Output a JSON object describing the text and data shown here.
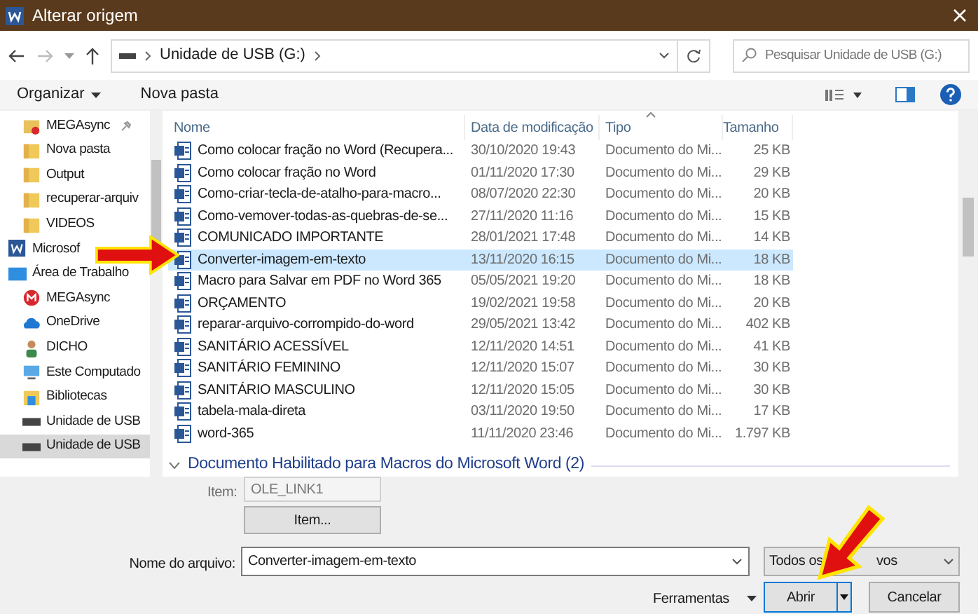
{
  "window": {
    "title": "Alterar origem"
  },
  "address": {
    "path": "Unidade de USB (G:)",
    "search_placeholder": "Pesquisar Unidade de USB (G:)"
  },
  "toolbar": {
    "organize": "Organizar",
    "new_folder": "Nova pasta"
  },
  "sidebar": {
    "items": [
      {
        "label": "MEGAsync",
        "kind": "megafolder",
        "indented": true,
        "pinned": true,
        "selected": false
      },
      {
        "label": "Nova pasta",
        "kind": "folder",
        "indented": true,
        "pinned": false,
        "selected": false
      },
      {
        "label": "Output",
        "kind": "folder",
        "indented": true,
        "pinned": false,
        "selected": false
      },
      {
        "label": "recuperar-arquiv",
        "kind": "folder",
        "indented": true,
        "pinned": false,
        "selected": false
      },
      {
        "label": "VIDEOS",
        "kind": "folder",
        "indented": true,
        "pinned": false,
        "selected": false
      },
      {
        "label": "Microsof",
        "kind": "word",
        "indented": false,
        "pinned": false,
        "selected": false
      },
      {
        "label": "Área de Trabalho",
        "kind": "desktop",
        "indented": false,
        "pinned": false,
        "selected": false
      },
      {
        "label": "MEGAsync",
        "kind": "mega",
        "indented": true,
        "pinned": false,
        "selected": false
      },
      {
        "label": "OneDrive",
        "kind": "cloud",
        "indented": true,
        "pinned": false,
        "selected": false
      },
      {
        "label": "DICHO",
        "kind": "user",
        "indented": true,
        "pinned": false,
        "selected": false
      },
      {
        "label": "Este Computado",
        "kind": "computer",
        "indented": true,
        "pinned": false,
        "selected": false
      },
      {
        "label": "Bibliotecas",
        "kind": "library",
        "indented": true,
        "pinned": false,
        "selected": false
      },
      {
        "label": "Unidade de USB",
        "kind": "drive",
        "indented": true,
        "pinned": false,
        "selected": false
      },
      {
        "label": "Unidade de USB",
        "kind": "drive",
        "indented": true,
        "pinned": false,
        "selected": true
      }
    ]
  },
  "table": {
    "columns": [
      "Nome",
      "Data de modificação",
      "Tipo",
      "Tamanho"
    ],
    "rows": [
      {
        "name": "Como colocar fração no Word (Recupera...",
        "date": "30/10/2020 19:43",
        "type": "Documento do Mi...",
        "size": "25 KB",
        "selected": false
      },
      {
        "name": "Como colocar fração no Word",
        "date": "01/11/2020 17:30",
        "type": "Documento do Mi...",
        "size": "29 KB",
        "selected": false
      },
      {
        "name": "Como-criar-tecla-de-atalho-para-macro...",
        "date": "08/07/2020 22:30",
        "type": "Documento do Mi...",
        "size": "20 KB",
        "selected": false
      },
      {
        "name": "Como-vemover-todas-as-quebras-de-se...",
        "date": "27/11/2020 11:16",
        "type": "Documento do Mi...",
        "size": "15 KB",
        "selected": false
      },
      {
        "name": "COMUNICADO IMPORTANTE",
        "date": "28/01/2021 17:48",
        "type": "Documento do Mi...",
        "size": "14 KB",
        "selected": false
      },
      {
        "name": "Converter-imagem-em-texto",
        "date": "13/11/2020 16:15",
        "type": "Documento do Mi...",
        "size": "18 KB",
        "selected": true
      },
      {
        "name": "Macro para Salvar em PDF no Word 365",
        "date": "05/05/2021 19:20",
        "type": "Documento do Mi...",
        "size": "18 KB",
        "selected": false
      },
      {
        "name": "ORÇAMENTO",
        "date": "19/02/2021 19:58",
        "type": "Documento do Mi...",
        "size": "20 KB",
        "selected": false
      },
      {
        "name": "reparar-arquivo-corrompido-do-word",
        "date": "29/05/2021 13:42",
        "type": "Documento do Mi...",
        "size": "402 KB",
        "selected": false
      },
      {
        "name": "SANITÁRIO ACESSÍVEL",
        "date": "12/11/2020 14:51",
        "type": "Documento do Mi...",
        "size": "41 KB",
        "selected": false
      },
      {
        "name": "SANITÁRIO FEMININO",
        "date": "12/11/2020 15:07",
        "type": "Documento do Mi...",
        "size": "30 KB",
        "selected": false
      },
      {
        "name": "SANITÁRIO MASCULINO",
        "date": "12/11/2020 15:05",
        "type": "Documento do Mi...",
        "size": "30 KB",
        "selected": false
      },
      {
        "name": "tabela-mala-direta",
        "date": "03/11/2020 19:50",
        "type": "Documento do Mi...",
        "size": "17 KB",
        "selected": false
      },
      {
        "name": "word-365",
        "date": "11/11/2020 23:46",
        "type": "Documento do Mi...",
        "size": "1.797 KB",
        "selected": false
      }
    ],
    "group": {
      "label": "Documento Habilitado para Macros do Microsoft Word (2)",
      "expanded": true
    }
  },
  "bottom": {
    "item_label": "Item:",
    "item_value": "OLE_LINK1",
    "item_button": "Item...",
    "filename_label": "Nome do arquivo:",
    "filename": "Converter-imagem-em-texto",
    "filter_visible_start": "Todos os",
    "filter_visible_end": "vos",
    "tools": "Ferramentas",
    "open": "Abrir",
    "cancel": "Cancelar"
  }
}
